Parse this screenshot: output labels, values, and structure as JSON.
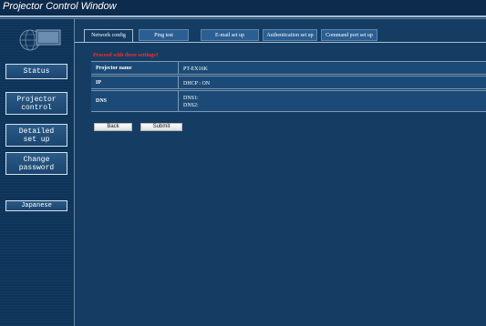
{
  "window": {
    "title": "Projector Control Window"
  },
  "sidebar": {
    "status": "Status",
    "projector_control": "Projector\ncontrol",
    "detailed_set_up": "Detailed\nset up",
    "change_password": "Change\npassword",
    "language": "Japanese"
  },
  "tabs": {
    "network_config": "Network config",
    "ping_test": "Ping test",
    "email_set_up": "E-mail set up",
    "authentication_set_up": "Authentication set up",
    "command_port_set_up": "Command port set up"
  },
  "form": {
    "prompt": "Proceed with these settings?",
    "rows": [
      {
        "label": "Projector name",
        "value": "PT-EX16K"
      },
      {
        "label": "IP",
        "value": "DHCP : ON"
      },
      {
        "label": "DNS",
        "value": "DNS1:\nDNS2:"
      }
    ],
    "back_label": "Back",
    "submit_label": "Submit"
  },
  "colors": {
    "background": "#153d63",
    "titlebar": "#0d2b4c",
    "warning_text": "#ff2a2a",
    "tab_inactive": "#2b5f92"
  },
  "icons": {
    "logo": "globe-monitor-icon"
  }
}
